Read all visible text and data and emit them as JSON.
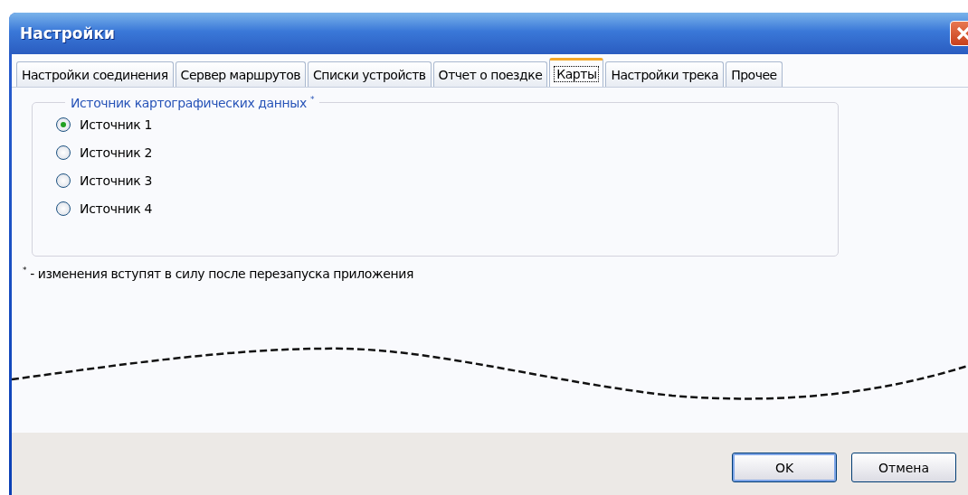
{
  "window": {
    "title": "Настройки"
  },
  "tabs": [
    {
      "label": "Настройки соединения",
      "selected": false
    },
    {
      "label": "Сервер маршрутов",
      "selected": false
    },
    {
      "label": "Списки устройств",
      "selected": false
    },
    {
      "label": "Отчет о поездке",
      "selected": false
    },
    {
      "label": "Карты",
      "selected": true
    },
    {
      "label": "Настройки трека",
      "selected": false
    },
    {
      "label": "Прочее",
      "selected": false
    }
  ],
  "group": {
    "title": "Источник картографических данных",
    "title_mark": "*",
    "options": [
      {
        "label": "Источник 1",
        "selected": true
      },
      {
        "label": "Источник 2",
        "selected": false
      },
      {
        "label": "Источник 3",
        "selected": false
      },
      {
        "label": "Источник 4",
        "selected": false
      }
    ]
  },
  "note": {
    "mark": "*",
    "text": " - изменения вступят в силу после перезапуска приложения"
  },
  "buttons": [
    {
      "label": "OK",
      "default": true
    },
    {
      "label": "Отмена",
      "default": false
    }
  ]
}
